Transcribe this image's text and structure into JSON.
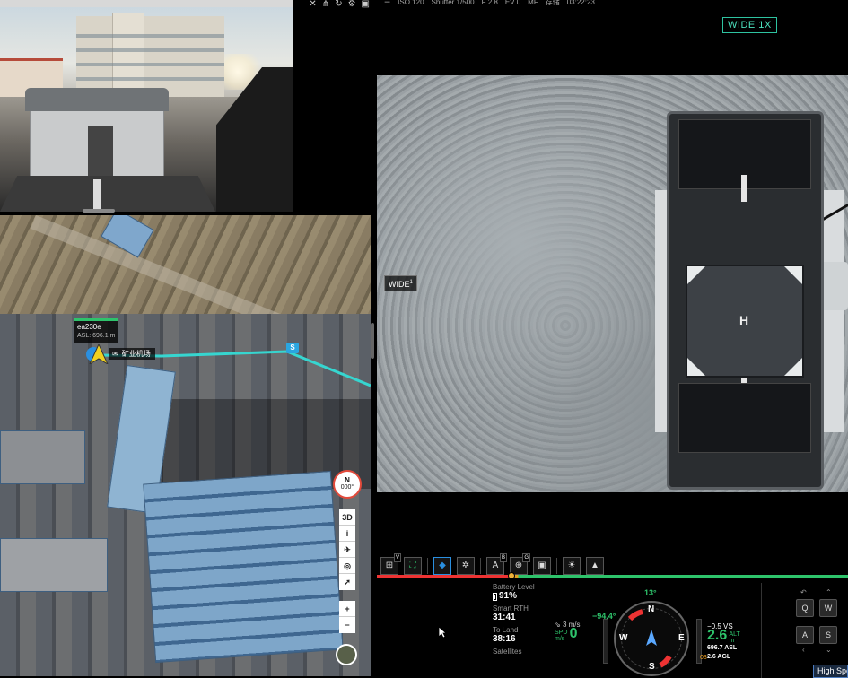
{
  "colors": {
    "accent_green": "#2ec36b",
    "lens_badge": "#4be0bd",
    "active_blue": "#2a8fe0",
    "warning_orange": "#f0a020",
    "danger_red": "#e33333"
  },
  "dock_feed": {
    "icon": "dock-camera-view"
  },
  "top_icons": [
    "signal-icon",
    "antenna-icon",
    "refresh-icon",
    "gear-icon",
    "window-icon"
  ],
  "camera_status_bar": {
    "menu_icon": "menu-icon",
    "iso": "ISO 120",
    "shutter": "Shutter 1/500",
    "fstop": "F 2.8",
    "ev": "EV 0",
    "mode": "MF",
    "storage_label": "存储",
    "time": "03:22:23"
  },
  "lens_badge": "WIDE 1X",
  "wide_tag": {
    "label": "WIDE",
    "index": "1"
  },
  "map": {
    "aircraft": {
      "name": "ea230e",
      "asl": "ASL: 696.1 m"
    },
    "dock_label": "矿业机场",
    "waypoint": "S",
    "compass": {
      "north": "N",
      "heading": "000°"
    },
    "buttons": {
      "view_3d": "3D",
      "info": "i",
      "aircraft": "✈",
      "locate": "◎",
      "route": "➚",
      "zoom_in": "+",
      "zoom_out": "−"
    }
  },
  "toolbar": {
    "tools": [
      {
        "name": "grid-tool-icon",
        "glyph": "⊞",
        "sub": "V"
      },
      {
        "name": "ai-target-icon",
        "glyph": "⛶",
        "sub": ""
      },
      {
        "name": "diamond-icon",
        "glyph": "◆",
        "sub": ""
      },
      {
        "name": "sparkle-icon",
        "glyph": "✲",
        "sub": ""
      },
      {
        "name": "ai-scan-icon",
        "glyph": "A",
        "sub": "B"
      },
      {
        "name": "ai-focus-icon",
        "glyph": "⊕",
        "sub": "G"
      },
      {
        "name": "ai-screen-icon",
        "glyph": "▣",
        "sub": ""
      },
      {
        "name": "light-icon",
        "glyph": "☀",
        "sub": ""
      },
      {
        "name": "navigate-icon",
        "glyph": "▲",
        "sub": ""
      }
    ]
  },
  "telemetry": {
    "battery_label": "Battery Level",
    "battery_value": "91%",
    "rth_label": "Smart RTH",
    "rth_value": "31:41",
    "land_label": "To Land",
    "land_value": "38:16",
    "satellites_label": "Satellites"
  },
  "hud": {
    "heading": "13°",
    "pitch": "−94.4°",
    "wind": "3 m/s",
    "speed_label": "SPD",
    "speed_unit": "m/s",
    "speed": "0",
    "vs": "−0.5 VS",
    "alt": "2.6",
    "alt_label": "ALT",
    "alt_unit": "m",
    "asl": "696.7 ASL",
    "agl": "2.6 AGL",
    "marker": "03",
    "compass_marks": {
      "n": "N",
      "e": "E",
      "s": "S",
      "w": "W"
    }
  },
  "keys": {
    "q": "Q",
    "w": "W",
    "a": "A",
    "s": "S"
  },
  "high_speed": "High Speed"
}
